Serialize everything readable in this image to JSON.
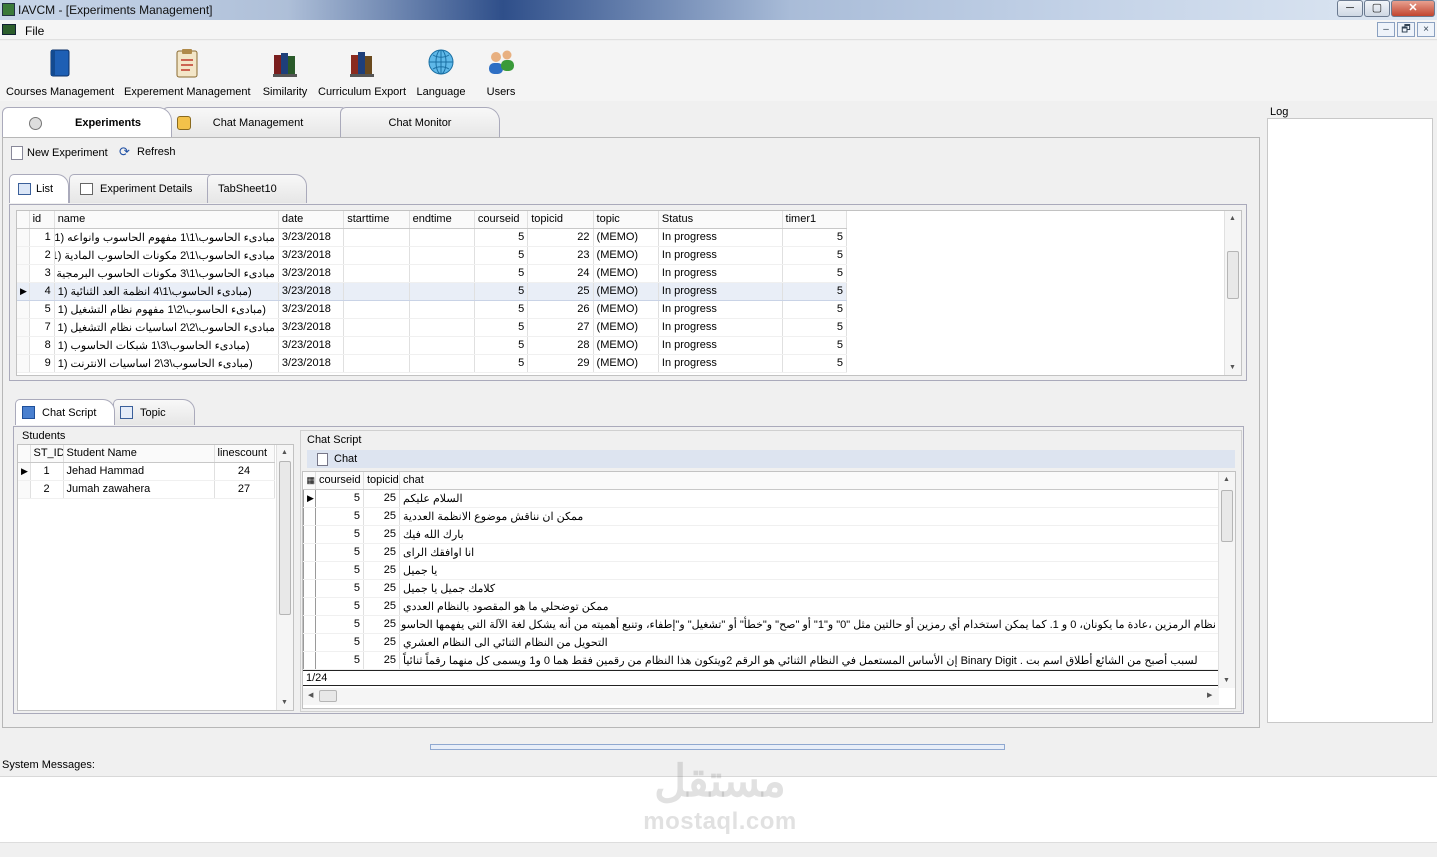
{
  "window": {
    "title": "IAVCM - [Experiments Management]",
    "buttons": [
      "─",
      "▢",
      "✕"
    ]
  },
  "menu": {
    "file": "File",
    "mdi_buttons": [
      "–",
      "🗗",
      "×"
    ]
  },
  "toolbar": {
    "items": [
      {
        "label": "Courses Management",
        "icon": "book-icon"
      },
      {
        "label": "Experement Management",
        "icon": "clipboard-icon"
      },
      {
        "label": "Similarity",
        "icon": "books-icon"
      },
      {
        "label": "Curriculum Export",
        "icon": "books-export-icon"
      },
      {
        "label": "Language",
        "icon": "globe-icon"
      },
      {
        "label": "Users",
        "icon": "users-icon"
      }
    ]
  },
  "main_tabs": [
    "Experiments",
    "Chat Management",
    "Chat Monitor"
  ],
  "log": {
    "label": "Log"
  },
  "actions": {
    "new_experiment": "New Experiment",
    "refresh": "Refresh"
  },
  "sub_tabs": [
    "List",
    "Experiment Details",
    "TabSheet10"
  ],
  "experiments": {
    "columns": [
      "id",
      "name",
      "date",
      "starttime",
      "endtime",
      "courseid",
      "topicid",
      "topic",
      "Status",
      "timer1"
    ],
    "rows": [
      [
        "1",
        "مبادىء الحاسوب\\1\\1 مفهوم الحاسوب وانواعه (1",
        "3/23/2018",
        "",
        "",
        "5",
        "22",
        "(MEMO)",
        "In progress",
        "5"
      ],
      [
        "2",
        "مبادىء الحاسوب\\1\\2 مكونات الحاسوب المادية (1",
        "3/23/2018",
        "",
        "",
        "5",
        "23",
        "(MEMO)",
        "In progress",
        "5"
      ],
      [
        "3",
        "مبادىء الحاسوب\\1\\3 مكونات الحاسوب البرمجية (1",
        "3/23/2018",
        "",
        "",
        "5",
        "24",
        "(MEMO)",
        "In progress",
        "5"
      ],
      [
        "4",
        "(مبادىء الحاسوب\\1\\4 انظمة العد الثنائية (1",
        "3/23/2018",
        "",
        "",
        "5",
        "25",
        "(MEMO)",
        "In progress",
        "5"
      ],
      [
        "5",
        "(مبادىء الحاسوب\\2\\1 مفهوم نظام التشغيل (1",
        "3/23/2018",
        "",
        "",
        "5",
        "26",
        "(MEMO)",
        "In progress",
        "5"
      ],
      [
        "7",
        "مبادىء الحاسوب\\2\\2 اساسيات نظام التشغيل (1",
        "3/23/2018",
        "",
        "",
        "5",
        "27",
        "(MEMO)",
        "In progress",
        "5"
      ],
      [
        "8",
        "(مبادىء الحاسوب\\3\\1 شبكات الحاسوب (1",
        "3/23/2018",
        "",
        "",
        "5",
        "28",
        "(MEMO)",
        "In progress",
        "5"
      ],
      [
        "9",
        "(مبادىء الحاسوب\\3\\2 اساسيات الانترنت (1",
        "3/23/2018",
        "",
        "",
        "5",
        "29",
        "(MEMO)",
        "In progress",
        "5"
      ]
    ],
    "selected_row": 3
  },
  "chat_tabs": [
    "Chat Script",
    "Topic"
  ],
  "students": {
    "label": "Students",
    "columns": [
      "ST_ID",
      "Student Name",
      "linescount"
    ],
    "rows": [
      [
        "1",
        "Jehad Hammad",
        "24"
      ],
      [
        "2",
        "Jumah zawahera",
        "27"
      ]
    ]
  },
  "chat_script": {
    "label": "Chat Script",
    "tab": "Chat",
    "columns": [
      "courseid",
      "topicid",
      "chat"
    ],
    "rows": [
      [
        "5",
        "25",
        "السلام عليكم"
      ],
      [
        "5",
        "25",
        "ممكن ان نناقش موضوع الانظمة العددية"
      ],
      [
        "5",
        "25",
        "بارك الله فيك"
      ],
      [
        "5",
        "25",
        "انا اوافقك الراى"
      ],
      [
        "5",
        "25",
        "يا جميل"
      ],
      [
        "5",
        "25",
        "كلامك جميل يا جميل"
      ],
      [
        "5",
        "25",
        "ممكن توضحلي ما هو المقصود بالنظام العددي"
      ],
      [
        "5",
        "25",
        "نظام الرمزين ،عادة ما يكونان، 0 و 1. كما يمكن استخدام أي رمزين أو حالتين مثل \"0\" و\"1\" أو \"صح\" و\"خطأ\" أو \"تشغيل\" و\"إطفاء، وتنبع أهميته من أنه يشكل لغة الآلة التي يفهمها الحاسوب"
      ],
      [
        "5",
        "25",
        "التحويل من النظام الثنائي الى النظام العشري"
      ],
      [
        "5",
        "25",
        "لسبب أصبح من الشائع أطلاق اسم بت . Binary Digit إن الأساس المستعمل في النظام الثنائي هو الرقم  2ويتكون هذا النظام من رقمين فقط هما  0 و1  ويسمى كل منهما رقماً ثنائياً"
      ]
    ],
    "pager": "1/24"
  },
  "system_messages": {
    "label": "System Messages:"
  },
  "watermark": {
    "arabic": "مستقل",
    "latin": "mostaql.com"
  }
}
